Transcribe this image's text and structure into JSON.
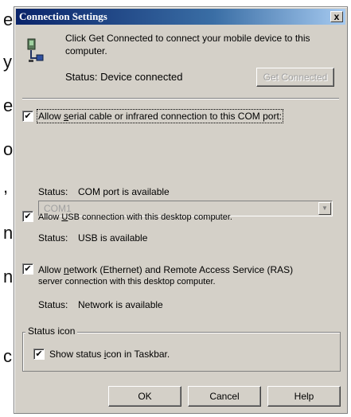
{
  "background_letters": [
    "e",
    "y",
    "e",
    "o",
    ",",
    "n",
    "n",
    "c"
  ],
  "dialog": {
    "title": "Connection Settings",
    "close_label": "x",
    "intro_text_1": "Click Get Connected to connect your mobile device to this",
    "intro_text_2": "computer.",
    "status_text": "Status: Device connected",
    "get_connected_label": "Get Connected"
  },
  "serial": {
    "checked": true,
    "label_pre": "Allow ",
    "label_u": "s",
    "label_post": "erial cable or infrared connection to this COM port:",
    "port_value": "COM1",
    "status_label": "Status:",
    "status_value": "COM port is available"
  },
  "usb": {
    "checked": true,
    "label_pre": "Allow ",
    "label_u": "U",
    "label_post": "SB connection with this desktop computer.",
    "status_label": "Status:",
    "status_value": "USB is available"
  },
  "network": {
    "checked": true,
    "label_pre": "Allow ",
    "label_u": "n",
    "label_post": "etwork (Ethernet) and Remote Access Service (RAS)",
    "label_line2": "server connection with this desktop computer.",
    "status_label": "Status:",
    "status_value": "Network is available"
  },
  "status_icon": {
    "group_label": "Status icon",
    "checked": true,
    "label_pre": "Show status ",
    "label_u": "i",
    "label_post": "con in Taskbar."
  },
  "buttons": {
    "ok": "OK",
    "cancel": "Cancel",
    "help": "Help"
  },
  "check_mark": "✔"
}
